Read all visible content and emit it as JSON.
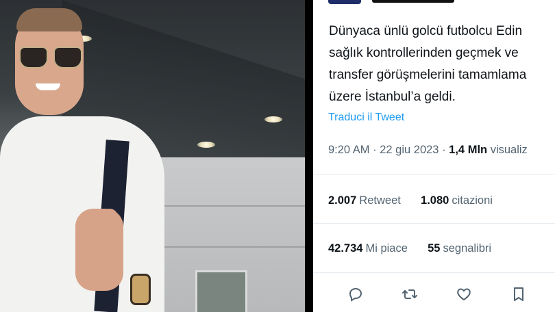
{
  "tweet": {
    "text_lines": [
      "Dünyaca ünlü golcü futbolcu Edin",
      "sağlık kontrollerinden geçmek ve",
      "transfer görüşmelerini tamamlama",
      "üzere İstanbul’a geldi."
    ],
    "translate_label": "Traduci il Tweet",
    "time": "9:20 AM",
    "separator": "·",
    "date": "22 giu 2023",
    "views_count": "1,4 Mln",
    "views_label": "visualiz"
  },
  "stats": {
    "retweets_count": "2.007",
    "retweets_label": "Retweet",
    "quotes_count": "1.080",
    "quotes_label": "citazioni",
    "likes_count": "42.734",
    "likes_label": "Mi piace",
    "bookmarks_count": "55",
    "bookmarks_label": "segnalibri"
  },
  "actions": {
    "icons": [
      "reply-icon",
      "retweet-icon",
      "like-icon",
      "bookmark-icon"
    ]
  },
  "colors": {
    "link": "#1d9bf0",
    "secondary_text": "#536471",
    "primary_text": "#0f1419",
    "header_avatar": "#1f2d6b"
  }
}
